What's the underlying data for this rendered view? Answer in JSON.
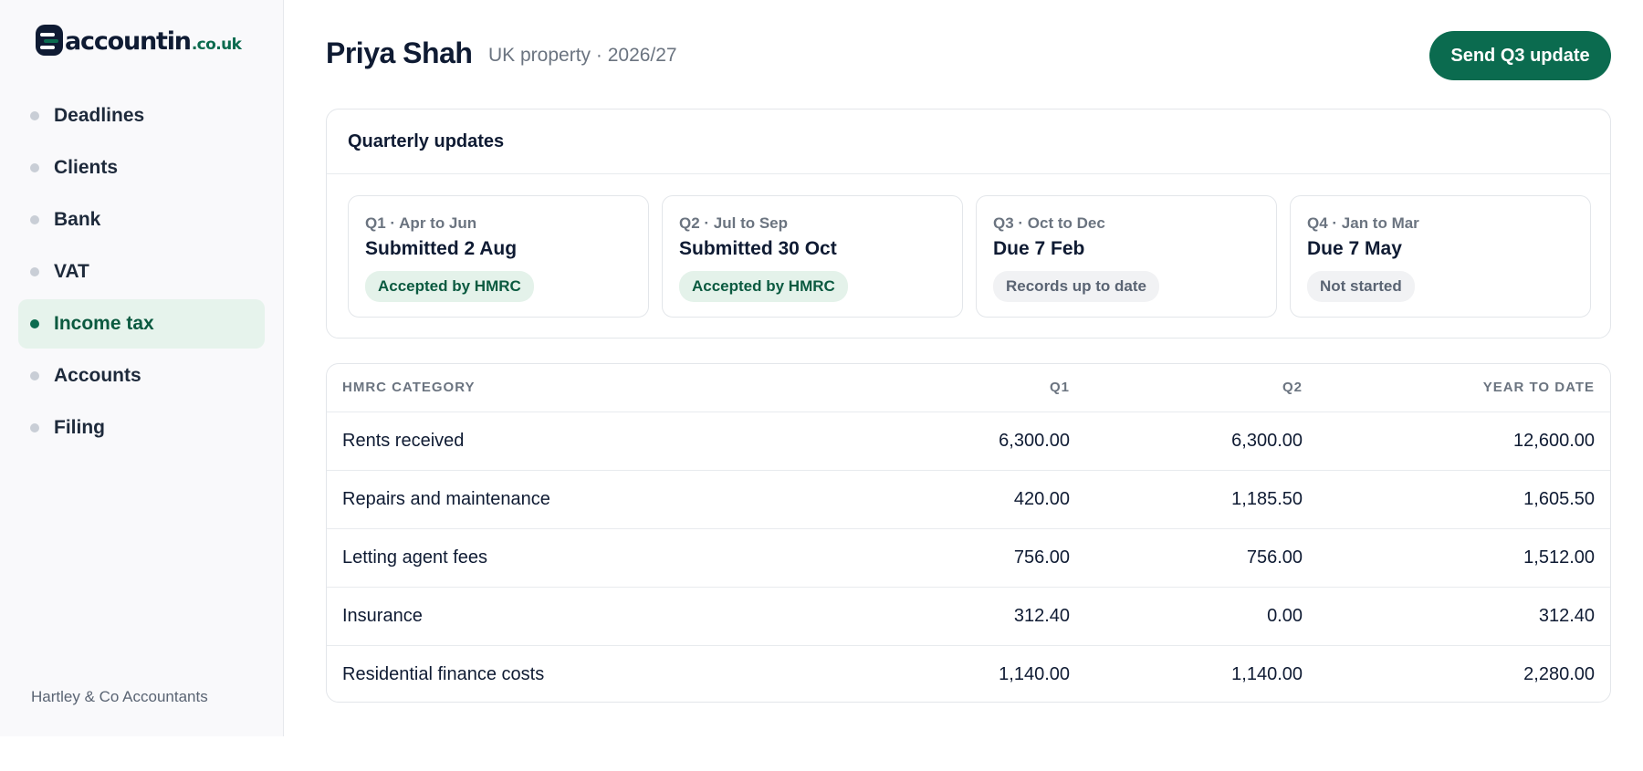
{
  "brand": {
    "name": "accountin",
    "tld": ".co.uk",
    "accent": "#0b6b4f"
  },
  "sidebar": {
    "items": [
      {
        "label": "Deadlines",
        "active": false
      },
      {
        "label": "Clients",
        "active": false
      },
      {
        "label": "Bank",
        "active": false
      },
      {
        "label": "VAT",
        "active": false
      },
      {
        "label": "Income tax",
        "active": true
      },
      {
        "label": "Accounts",
        "active": false
      },
      {
        "label": "Filing",
        "active": false
      }
    ],
    "firm": "Hartley & Co Accountants"
  },
  "header": {
    "client_name": "Priya Shah",
    "subtitle": "UK property · 2026/27",
    "action_label": "Send Q3 update"
  },
  "quarterly": {
    "title": "Quarterly updates",
    "cards": [
      {
        "period": "Q1 · Apr to Jun",
        "status": "Submitted 2 Aug",
        "badge": "Accepted by HMRC",
        "badge_tone": "ok"
      },
      {
        "period": "Q2 · Jul to Sep",
        "status": "Submitted 30 Oct",
        "badge": "Accepted by HMRC",
        "badge_tone": "ok"
      },
      {
        "period": "Q3 · Oct to Dec",
        "status": "Due 7 Feb",
        "badge": "Records up to date",
        "badge_tone": "neutral"
      },
      {
        "period": "Q4 · Jan to Mar",
        "status": "Due 7 May",
        "badge": "Not started",
        "badge_tone": "neutral"
      }
    ]
  },
  "table": {
    "headers": [
      "HMRC CATEGORY",
      "Q1",
      "Q2",
      "YEAR TO DATE"
    ],
    "rows": [
      [
        "Rents received",
        "6,300.00",
        "6,300.00",
        "12,600.00"
      ],
      [
        "Repairs and maintenance",
        "420.00",
        "1,185.50",
        "1,605.50"
      ],
      [
        "Letting agent fees",
        "756.00",
        "756.00",
        "1,512.00"
      ],
      [
        "Insurance",
        "312.40",
        "0.00",
        "312.40"
      ],
      [
        "Residential finance costs",
        "1,140.00",
        "1,140.00",
        "2,280.00"
      ]
    ]
  }
}
